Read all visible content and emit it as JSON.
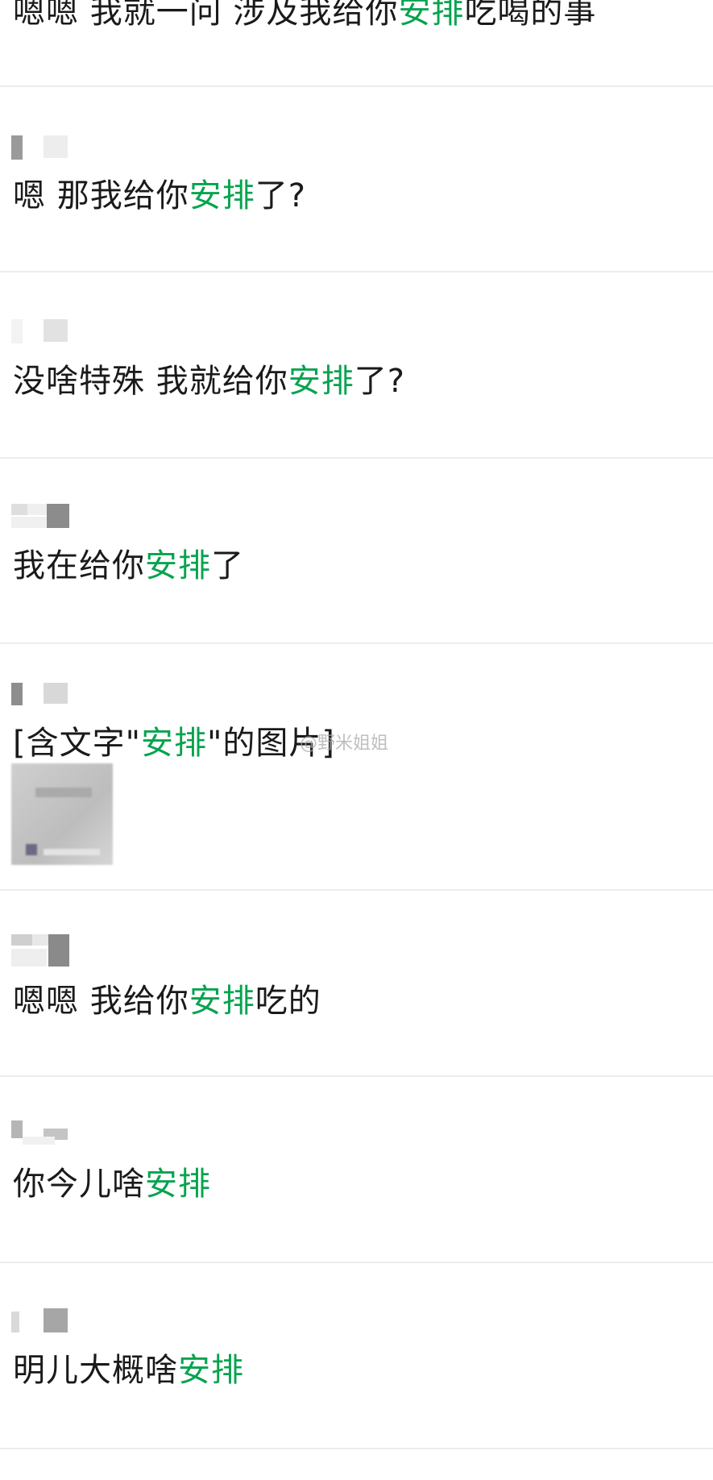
{
  "highlight_color": "#07a34f",
  "keyword": "安排",
  "watermark": "@野米姐姐",
  "rows": [
    {
      "before": "嗯嗯 我就一问 涉及我给你",
      "kw": "安排",
      "after": "吃喝的事"
    },
    {
      "before": "嗯 那我给你",
      "kw": "安排",
      "after": "了?"
    },
    {
      "before": "没啥特殊 我就给你",
      "kw": "安排",
      "after": "了?"
    },
    {
      "before": "我在给你",
      "kw": "安排",
      "after": "了"
    },
    {
      "before": "[含文字\"",
      "kw": "安排",
      "after": "\"的图片]",
      "has_image": true
    },
    {
      "before": "嗯嗯 我给你",
      "kw": "安排",
      "after": "吃的"
    },
    {
      "before": "你今儿啥",
      "kw": "安排",
      "after": ""
    },
    {
      "before": "明儿大概啥",
      "kw": "安排",
      "after": ""
    }
  ]
}
